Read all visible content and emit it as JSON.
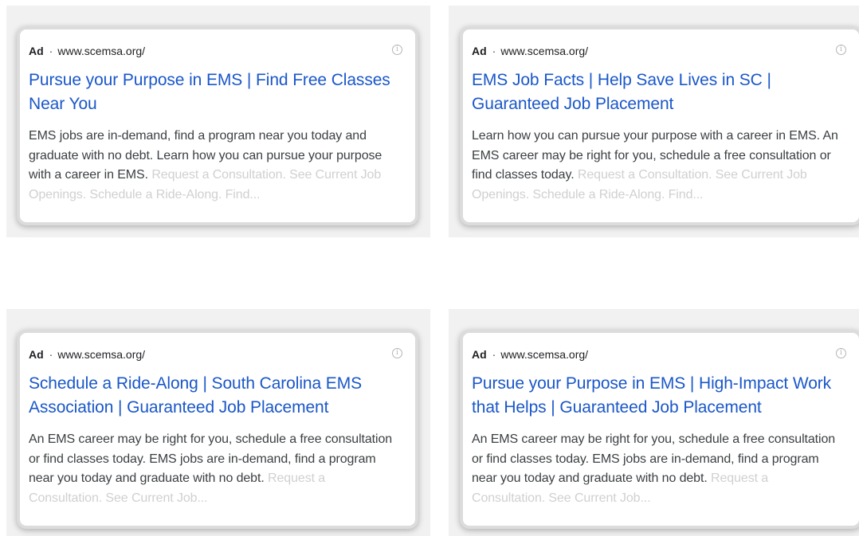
{
  "ads": [
    {
      "badge": "Ad",
      "separator": "·",
      "url": "www.scemsa.org/",
      "headline": "Pursue your Purpose in EMS | Find Free Classes Near You",
      "description": "EMS jobs are in-demand, find a program near you today and graduate with no debt. Learn how you can pursue your purpose with a career in EMS.",
      "extensions": "Request a Consultation. See Current Job Openings. Schedule a Ride-Along. Find...",
      "info_icon": "info-icon"
    },
    {
      "badge": "Ad",
      "separator": "·",
      "url": "www.scemsa.org/",
      "headline": "EMS Job Facts | Help Save Lives in SC | Guaranteed Job Placement",
      "description": "Learn how you can pursue your purpose with a career in EMS. An EMS career may be right for you, schedule a free consultation or find classes today.",
      "extensions": "Request a Consultation. See Current Job Openings. Schedule a Ride-Along. Find...",
      "info_icon": "info-icon"
    },
    {
      "badge": "Ad",
      "separator": "·",
      "url": "www.scemsa.org/",
      "headline": "Schedule a Ride-Along | South Carolina EMS Association | Guaranteed Job Placement",
      "description": "An EMS career may be right for you, schedule a free consultation or find classes today. EMS jobs are in-demand, find a program near you today and graduate with no debt.",
      "extensions": "Request a Consultation. See Current Job...",
      "info_icon": "info-icon"
    },
    {
      "badge": "Ad",
      "separator": "·",
      "url": "www.scemsa.org/",
      "headline": "Pursue your Purpose in EMS | High-Impact Work that Helps | Guaranteed Job Placement",
      "description": "An EMS career may be right for you, schedule a free consultation or find classes today. EMS jobs are in-demand, find a program near you today and graduate with no debt.",
      "extensions": "Request a Consultation. See Current Job...",
      "info_icon": "info-icon"
    }
  ],
  "colors": {
    "headline": "#1a57c9",
    "body_text": "#3c4043",
    "faded_text": "#d0d0d0",
    "frame_bg": "#f1f1f1"
  }
}
